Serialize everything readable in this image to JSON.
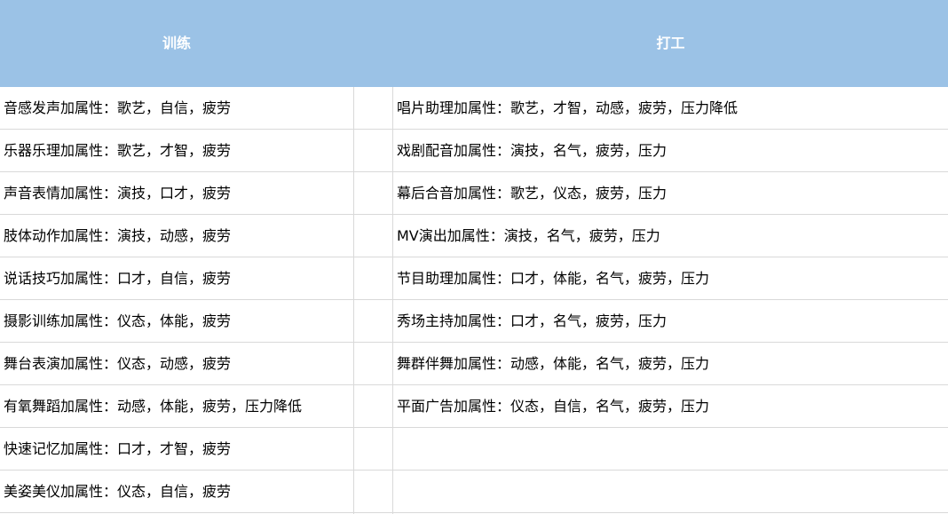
{
  "header": {
    "left_title": "训练",
    "right_title": "打工"
  },
  "training": [
    "音感发声加属性：歌艺，自信，疲劳",
    "乐器乐理加属性：歌艺，才智，疲劳",
    "声音表情加属性：演技，口才，疲劳",
    "肢体动作加属性：演技，动感，疲劳",
    "说话技巧加属性：口才，自信，疲劳",
    "摄影训练加属性：仪态，体能，疲劳",
    "舞台表演加属性：仪态，动感，疲劳",
    "有氧舞蹈加属性：动感，体能，疲劳，压力降低",
    "快速记忆加属性：口才，才智，疲劳",
    "美姿美仪加属性：仪态，自信，疲劳"
  ],
  "work": [
    "唱片助理加属性：歌艺，才智，动感，疲劳，压力降低",
    "戏剧配音加属性：演技，名气，疲劳，压力",
    "幕后合音加属性：歌艺，仪态，疲劳，压力",
    "MV演出加属性：演技，名气，疲劳，压力",
    "节目助理加属性：口才，体能，名气，疲劳，压力",
    "秀场主持加属性：口才，名气，疲劳，压力",
    "舞群伴舞加属性：动感，体能，名气，疲劳，压力",
    "平面广告加属性：仪态，自信，名气，疲劳，压力",
    "",
    ""
  ],
  "colors": {
    "header_bg": "#9bc2e6",
    "header_text": "#ffffff",
    "grid_line": "#d9d9d9"
  }
}
